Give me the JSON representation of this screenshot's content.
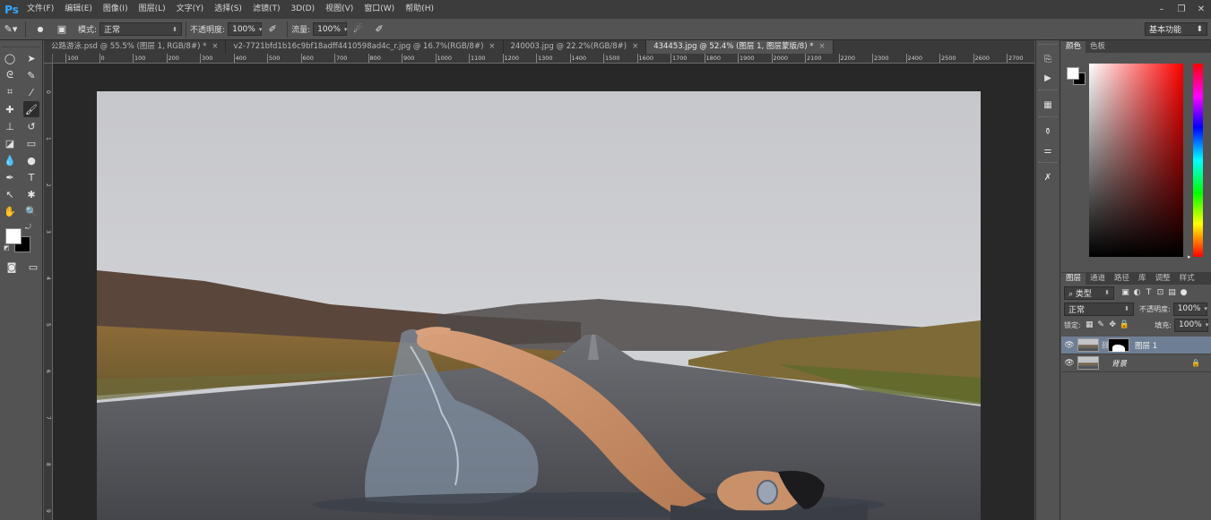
{
  "app": {
    "logo": "Ps",
    "menu": [
      "文件(F)",
      "编辑(E)",
      "图像(I)",
      "图层(L)",
      "文字(Y)",
      "选择(S)",
      "滤镜(T)",
      "3D(D)",
      "视图(V)",
      "窗口(W)",
      "帮助(H)"
    ],
    "window_controls": [
      "minimize-icon",
      "restore-icon",
      "close-icon"
    ]
  },
  "options": {
    "brush_size": "13",
    "mode_label": "模式:",
    "mode_value": "正常",
    "opacity_label": "不透明度:",
    "opacity_value": "100%",
    "flow_label": "流量:",
    "flow_value": "100%",
    "workspace": "基本功能"
  },
  "tabs": [
    {
      "label": "公路游泳.psd @ 55.5% (图层 1, RGB/8#) *",
      "active": false
    },
    {
      "label": "v2-7721bfd1b16c9bf18adff4410598ad4c_r.jpg @ 16.7%(RGB/8#)",
      "active": false
    },
    {
      "label": "240003.jpg @ 22.2%(RGB/8#)",
      "active": false
    },
    {
      "label": "434453.jpg @ 52.4% (图层 1, 图层蒙版/8) *",
      "active": true
    }
  ],
  "tab_close": "×",
  "ruler_h": [
    "100",
    "0",
    "100",
    "200",
    "300",
    "400",
    "500",
    "600",
    "700",
    "800",
    "900",
    "1000",
    "1100",
    "1200",
    "1300",
    "1400",
    "1500",
    "1600",
    "1700",
    "1800",
    "1900",
    "2000",
    "2100",
    "2200",
    "2300",
    "2400",
    "2500",
    "2600",
    "2700"
  ],
  "ruler_v": [
    "0",
    "1",
    "2",
    "3",
    "4",
    "5",
    "6",
    "7",
    "8",
    "9"
  ],
  "color_panel": {
    "tabs": [
      "颜色",
      "色板"
    ],
    "foreground": "#ffffff",
    "background": "#000000",
    "hue": "#ff0000"
  },
  "layers_panel": {
    "tabs": [
      "图层",
      "通道",
      "路径",
      "库",
      "调整",
      "样式"
    ],
    "filter_kind": "类型",
    "blend_mode": "正常",
    "opacity_label": "不透明度:",
    "opacity_value": "100%",
    "lock_label": "锁定:",
    "fill_label": "填充:",
    "fill_value": "100%",
    "layers": [
      {
        "name": "图层 1",
        "selected": true,
        "has_mask": true
      },
      {
        "name": "背景",
        "selected": false,
        "locked": true
      }
    ]
  }
}
